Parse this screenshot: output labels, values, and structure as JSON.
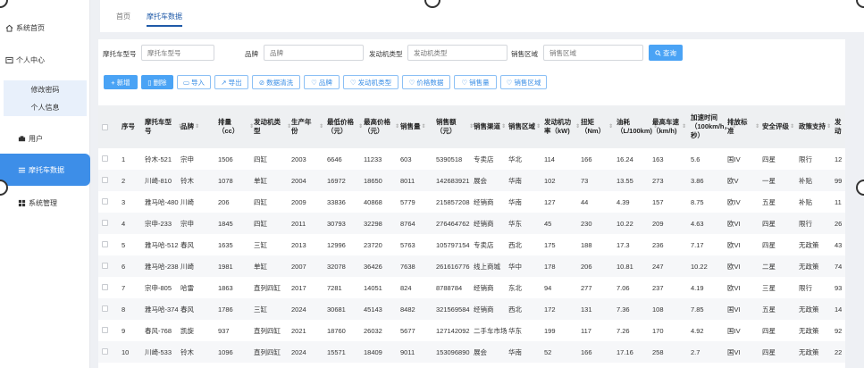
{
  "sidebar": {
    "items": [
      {
        "label": "系统首页",
        "icon": "home-icon"
      },
      {
        "label": "个人中心",
        "icon": "user-center-icon"
      },
      {
        "label": "用户",
        "icon": "user-icon"
      },
      {
        "label": "摩托车数据",
        "icon": "list-icon"
      },
      {
        "label": "系统管理",
        "icon": "grid-icon"
      }
    ],
    "submenu": [
      "修改密码",
      "个人信息"
    ]
  },
  "breadcrumb": {
    "home": "首页",
    "current": "摩托车数据"
  },
  "search": {
    "fields": [
      {
        "label": "摩托车型号",
        "placeholder": "摩托车型号"
      },
      {
        "label": "品牌",
        "placeholder": "品牌"
      },
      {
        "label": "发动机类型",
        "placeholder": "发动机类型"
      },
      {
        "label": "销售区域",
        "placeholder": "销售区域"
      }
    ],
    "query_label": "查询"
  },
  "toolbar": {
    "buttons": [
      "新增",
      "删除",
      "导入",
      "导出",
      "数据清洗",
      "品牌",
      "发动机类型",
      "价格数据",
      "销售量",
      "销售区域"
    ]
  },
  "table": {
    "headers": [
      "序号",
      "摩托车型号",
      "品牌",
      "排量（cc）",
      "发动机类型",
      "生产年份",
      "最低价格（元）",
      "最高价格（元）",
      "销售量",
      "销售额（元）",
      "销售渠道",
      "销售区域",
      "发动机功率（kW)",
      "扭矩（Nm）",
      "油耗（L/100km)",
      "最高车速（km/h)",
      "加速时间（100km/h，秒）",
      "排放标准",
      "安全评级",
      "政策支持",
      "发动"
    ],
    "rows": [
      [
        "1",
        "铃木-521",
        "宗申",
        "1506",
        "四缸",
        "2003",
        "6646",
        "11233",
        "603",
        "5390518",
        "专卖店",
        "华北",
        "114",
        "166",
        "16.24",
        "163",
        "5.6",
        "国IV",
        "四星",
        "限行",
        "12"
      ],
      [
        "2",
        "川崎-810",
        "铃木",
        "1078",
        "单缸",
        "2004",
        "16972",
        "18650",
        "8011",
        "142683921",
        "展会",
        "华南",
        "102",
        "73",
        "13.55",
        "273",
        "3.86",
        "欧V",
        "一星",
        "补贴",
        "99"
      ],
      [
        "3",
        "雅马哈-480",
        "川崎",
        "206",
        "四缸",
        "2009",
        "33836",
        "40868",
        "5779",
        "215857208",
        "经销商",
        "华南",
        "127",
        "44",
        "4.39",
        "157",
        "8.75",
        "欧IV",
        "五星",
        "补贴",
        "11"
      ],
      [
        "4",
        "宗申-233",
        "宗申",
        "1845",
        "四缸",
        "2011",
        "30793",
        "32298",
        "8764",
        "276464762",
        "经销商",
        "华东",
        "45",
        "230",
        "10.22",
        "209",
        "4.63",
        "欧VI",
        "四星",
        "限行",
        "26"
      ],
      [
        "5",
        "雅马哈-512",
        "春风",
        "1635",
        "三缸",
        "2013",
        "12996",
        "23720",
        "5763",
        "105797154",
        "专卖店",
        "西北",
        "175",
        "188",
        "17.3",
        "236",
        "7.17",
        "欧VI",
        "四星",
        "无政策",
        "43"
      ],
      [
        "6",
        "雅马哈-238",
        "川崎",
        "1981",
        "单缸",
        "2007",
        "32078",
        "36426",
        "7638",
        "261616776",
        "线上商城",
        "华中",
        "178",
        "206",
        "10.81",
        "247",
        "10.22",
        "欧VI",
        "二星",
        "无政策",
        "74"
      ],
      [
        "7",
        "宗申-805",
        "哈雷",
        "1863",
        "直列四缸",
        "2017",
        "7281",
        "14051",
        "824",
        "8788784",
        "经销商",
        "东北",
        "94",
        "277",
        "7.06",
        "237",
        "4.19",
        "欧VI",
        "三星",
        "限行",
        "93"
      ],
      [
        "8",
        "雅马哈-374",
        "春风",
        "1786",
        "三缸",
        "2024",
        "30681",
        "45143",
        "8482",
        "321569584",
        "经销商",
        "西北",
        "172",
        "131",
        "7.36",
        "108",
        "7.85",
        "国VI",
        "五星",
        "无政策",
        "14"
      ],
      [
        "9",
        "春风-768",
        "凯旋",
        "937",
        "直列四缸",
        "2021",
        "18760",
        "26032",
        "5677",
        "127142092",
        "二手车市场",
        "华东",
        "199",
        "117",
        "7.26",
        "170",
        "4.92",
        "国IV",
        "四星",
        "无政策",
        "92"
      ],
      [
        "10",
        "川崎-533",
        "铃木",
        "1096",
        "直列四缸",
        "2024",
        "15571",
        "18409",
        "9011",
        "153096890",
        "展会",
        "华南",
        "52",
        "166",
        "17.16",
        "258",
        "2.7",
        "国VI",
        "四星",
        "无政策",
        "22"
      ]
    ]
  }
}
